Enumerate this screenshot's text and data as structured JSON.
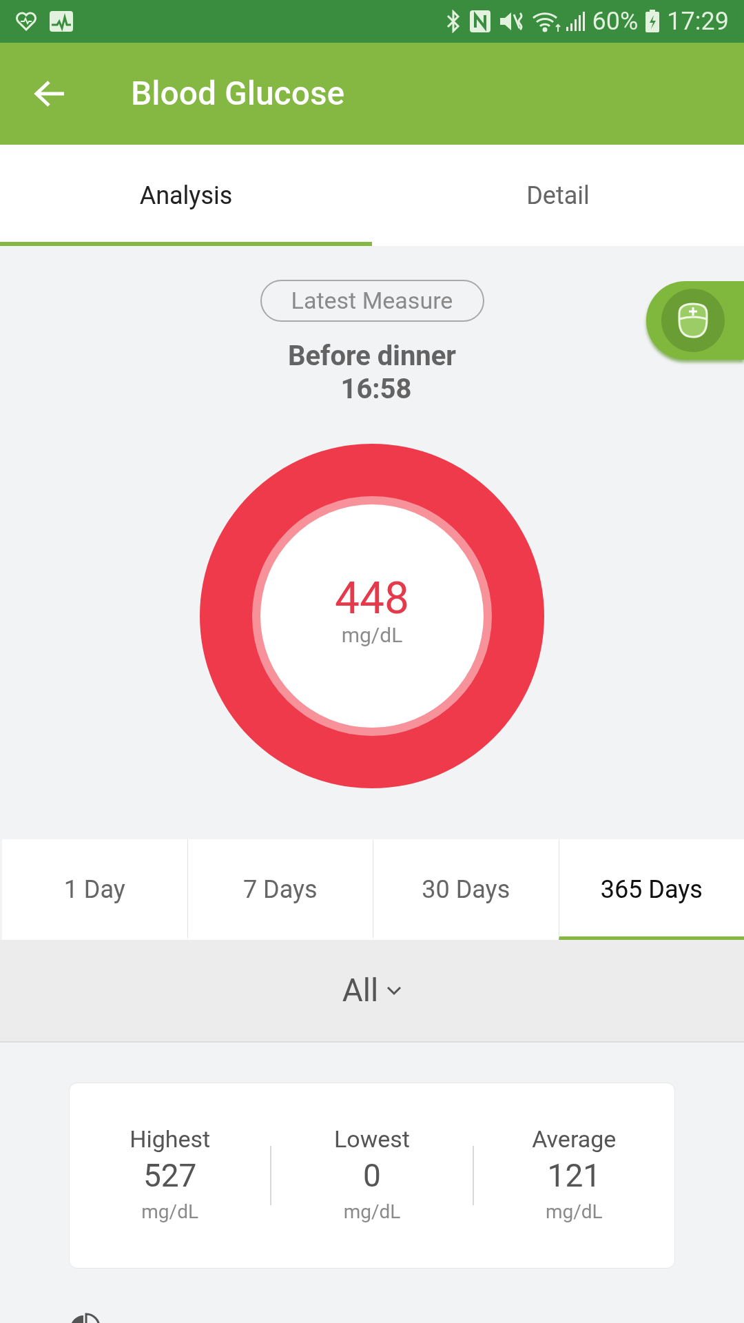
{
  "status_bar": {
    "battery_text": "60%",
    "time": "17:29"
  },
  "app_bar": {
    "title": "Blood Glucose"
  },
  "tabs": [
    {
      "label": "Analysis",
      "selected": true
    },
    {
      "label": "Detail",
      "selected": false
    }
  ],
  "latest": {
    "badge": "Latest Measure",
    "period": "Before dinner",
    "time": "16:58",
    "value": "448",
    "unit": "mg/dL"
  },
  "ranges": [
    {
      "label": "1 Day",
      "selected": false
    },
    {
      "label": "7 Days",
      "selected": false
    },
    {
      "label": "30 Days",
      "selected": false
    },
    {
      "label": "365 Days",
      "selected": true
    }
  ],
  "filter": {
    "label": "All"
  },
  "stats": [
    {
      "label": "Highest",
      "value": "527",
      "unit": "mg/dL"
    },
    {
      "label": "Lowest",
      "value": "0",
      "unit": "mg/dL"
    },
    {
      "label": "Average",
      "value": "121",
      "unit": "mg/dL"
    }
  ]
}
